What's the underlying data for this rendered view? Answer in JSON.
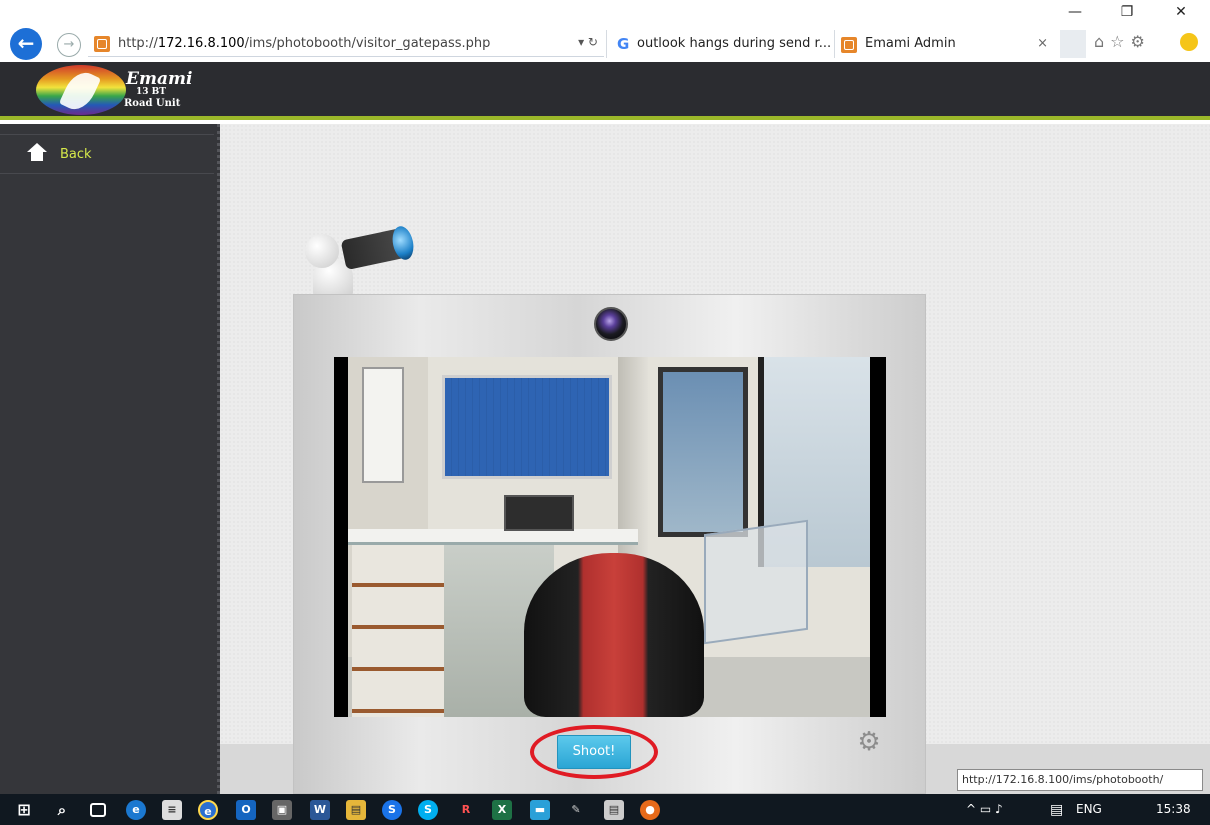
{
  "browser": {
    "url_prefix": "http://",
    "url_host": "172.16.8.100",
    "url_path": "/ims/photobooth/visitor_gatepass.php",
    "tabs": [
      {
        "label": "outlook hangs during send r..."
      },
      {
        "label": "Emami Admin"
      }
    ],
    "tab_close": "×",
    "window_controls": {
      "minimize": "—",
      "restore": "❐",
      "close": "✕"
    },
    "addr_controls": "▾ ↻"
  },
  "header": {
    "logo_line1": "Emami",
    "logo_line2": "13 BT",
    "logo_line3": "Road Unit"
  },
  "sidebar": {
    "back_label": "Back"
  },
  "photobooth": {
    "shoot_label": "Shoot!",
    "accent": "#2aa5d4",
    "highlight_color": "#e01b24"
  },
  "status": {
    "link_tooltip": "http://172.16.8.100/ims/photobooth/"
  },
  "taskbar": {
    "lang": "ENG",
    "time": "15:38",
    "tray_glyphs": "^ ▭ ♪"
  },
  "colors": {
    "header_bg": "#2b2c30",
    "header_accent": "#9cb82a",
    "sidebar_bg": "#35363a",
    "back_link_color": "#d5e84a",
    "browser_back": "#1d6fd6"
  }
}
